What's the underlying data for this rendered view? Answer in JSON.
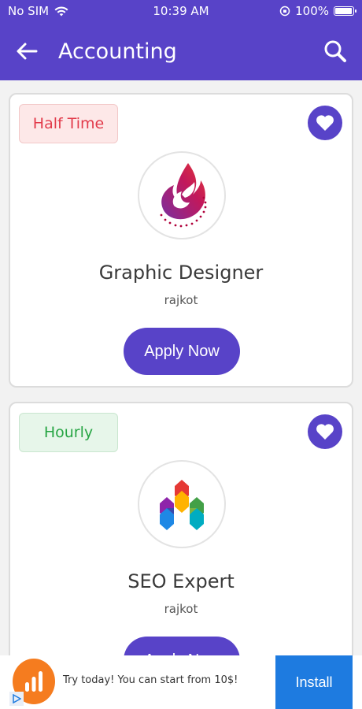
{
  "status_bar": {
    "carrier": "No SIM",
    "time": "10:39 AM",
    "battery": "100%",
    "battery_level": 1.0
  },
  "app_bar": {
    "title": "Accounting",
    "back_icon": "arrow-left-icon",
    "search_icon": "search-icon"
  },
  "jobs": [
    {
      "tag": "Half Time",
      "tag_color": "#e23b4b",
      "title": "Graphic Designer",
      "location": "rajkot",
      "apply_label": "Apply Now",
      "logo_icon": "flame-logo-icon"
    },
    {
      "tag": "Hourly",
      "tag_color": "#27a544",
      "title": "SEO Expert",
      "location": "rajkot",
      "apply_label": "Apply Now",
      "logo_icon": "colorful-m-logo-icon"
    }
  ],
  "ad": {
    "text": "Try today! You can start from 10$!",
    "install_label": "Install",
    "install_color": "#1e7be0"
  },
  "theme": {
    "primary": "#5843c8"
  }
}
